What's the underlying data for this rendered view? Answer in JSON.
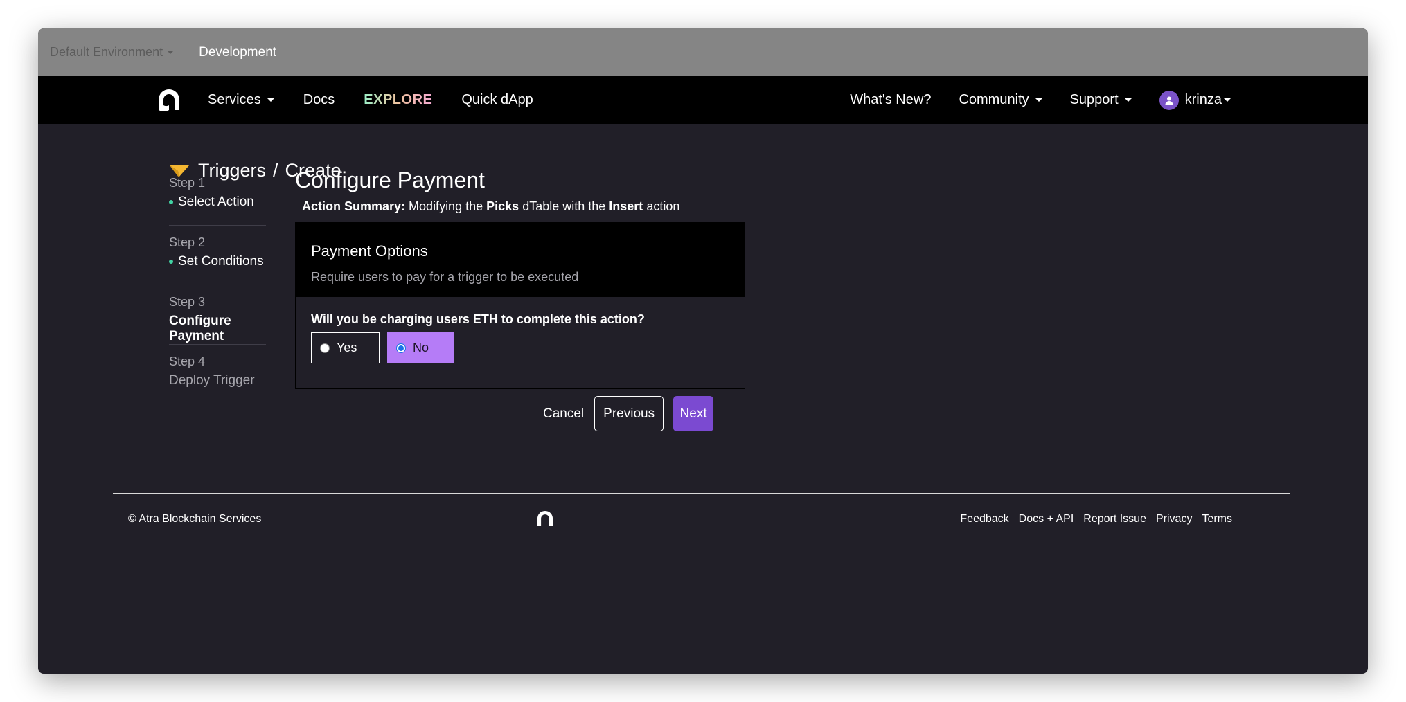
{
  "env": {
    "selected": "Default Environment",
    "current": "Development"
  },
  "nav": {
    "services": "Services",
    "docs": "Docs",
    "explore": "EXPLORE",
    "quick_dapp": "Quick dApp",
    "whats_new": "What's New?",
    "community": "Community",
    "support": "Support",
    "username": "krinza"
  },
  "breadcrumb": {
    "section": "Triggers",
    "separator": "/",
    "page": "Create"
  },
  "steps": [
    {
      "num": "Step 1",
      "label": "Select Action",
      "state": "done"
    },
    {
      "num": "Step 2",
      "label": "Set Conditions",
      "state": "done"
    },
    {
      "num": "Step 3",
      "label": "Configure Payment",
      "state": "current"
    },
    {
      "num": "Step 4",
      "label": "Deploy Trigger",
      "state": "pending"
    }
  ],
  "main": {
    "title": "Configure Payment",
    "summary_label": "Action Summary:",
    "summary_text_1": "Modifying the",
    "summary_table": "Picks",
    "summary_text_2": "dTable with the",
    "summary_action": "Insert",
    "summary_text_3": "action"
  },
  "card": {
    "title": "Payment Options",
    "subtitle": "Require users to pay for a trigger to be executed",
    "question": "Will you be charging users ETH to complete this action?",
    "option_yes": "Yes",
    "option_no": "No",
    "selected": "No"
  },
  "actions": {
    "cancel": "Cancel",
    "previous": "Previous",
    "next": "Next"
  },
  "footer": {
    "copyright": "© Atra Blockchain Services",
    "links": [
      "Feedback",
      "Docs + API",
      "Report Issue",
      "Privacy",
      "Terms"
    ]
  },
  "colors": {
    "accent": "#7b4ad1",
    "selected_option": "#b57cf7",
    "step_dot": "#42d3a4",
    "breadcrumb_icon": "#f5b731",
    "background": "#211f28"
  }
}
